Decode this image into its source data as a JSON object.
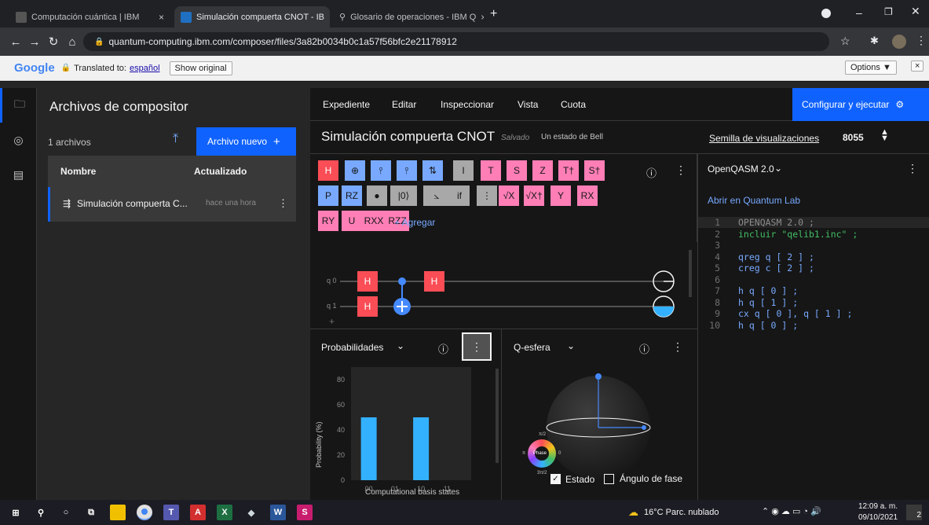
{
  "browser": {
    "tabs": [
      {
        "title": "Computación cuántica | IBM",
        "close": "×"
      },
      {
        "title": "Simulación compuerta CNOT - IB",
        "close": "×"
      },
      {
        "title": "Glosario de operaciones - IBM Q",
        "close": "×"
      }
    ],
    "new_tab": "+",
    "url": "quantum-computing.ibm.com/composer/files/3a82b0034b0c1a57f56bfc2e21178912",
    "translate": {
      "logo": "Google",
      "translated_to": "Translated to:",
      "language": "español",
      "show_original": "Show original",
      "options": "Options ▼",
      "close": "×"
    }
  },
  "files": {
    "title": "Archivos de compositor",
    "count": "1 archivos",
    "new_file": "Archivo nuevo",
    "plus": "+",
    "columns": {
      "name": "Nombre",
      "updated": "Actualizado"
    },
    "rows": [
      {
        "name": "Simulación compuerta C...",
        "updated": "hace una hora"
      }
    ]
  },
  "composer": {
    "menu": [
      "Expediente",
      "Editar",
      "Inspeccionar",
      "Vista",
      "Cuota"
    ],
    "run_label": "Configurar y ejecutar",
    "title": "Simulación compuerta CNOT",
    "saved": "Salvado",
    "tag": "Un estado de Bell",
    "seed_label": "Semilla de visualizaciones",
    "seed_value": "8055",
    "add_gate": "+ Agregar",
    "gates_row1": [
      "H",
      "⊕",
      "⫯",
      "⫯",
      "⇅",
      "I",
      "T",
      "S",
      "Z",
      "T†",
      "S†"
    ],
    "gates_row2": [
      "P",
      "RZ",
      "●",
      "|0⟩",
      "⦣",
      "if",
      "⋮",
      "√X",
      "√X†",
      "Y",
      "RX"
    ],
    "gates_row3": [
      "RY",
      "U",
      "RXX",
      "RZZ"
    ],
    "qubits": [
      "q 0",
      "q 1"
    ],
    "circuit_gates": {
      "h": "H",
      "target": "+"
    }
  },
  "probabilities": {
    "title": "Probabilidades",
    "xlabel": "Computational basis states",
    "ylabel": "Probability (%)"
  },
  "chart_data": {
    "type": "bar",
    "categories": [
      "00",
      "01",
      "10",
      "11"
    ],
    "values": [
      50,
      0,
      50,
      0
    ],
    "xlabel": "Computational basis states",
    "ylabel": "Probability (%)",
    "yticks": [
      0,
      20,
      40,
      60,
      80
    ],
    "ylim": [
      0,
      90
    ],
    "color": "#33b1ff"
  },
  "qsphere": {
    "title": "Q-esfera",
    "state_label": "Estado",
    "phase_label": "Ángulo de fase",
    "phase_wheel": {
      "center": "Phase",
      "top": "π/2",
      "left": "π",
      "right": "0",
      "bottom": "3π/2"
    }
  },
  "qasm": {
    "header": "OpenQASM 2.0",
    "lab_link": "Abrir en Quantum Lab",
    "lines": [
      {
        "n": "1",
        "code": "OPENQASM 2.0 ;"
      },
      {
        "n": "2",
        "code": "incluir \"qelib1.inc\" ;"
      },
      {
        "n": "3",
        "code": ""
      },
      {
        "n": "4",
        "code": "qreg q [ 2 ] ;"
      },
      {
        "n": "5",
        "code": "creg c [ 2 ] ;"
      },
      {
        "n": "6",
        "code": ""
      },
      {
        "n": "7",
        "code": "h q [ 0 ] ;"
      },
      {
        "n": "8",
        "code": "h q [ 1 ] ;"
      },
      {
        "n": "9",
        "code": "cx q [ 0 ], q [ 1 ] ;"
      },
      {
        "n": "10",
        "code": "h q [ 0 ] ;"
      }
    ]
  },
  "taskbar": {
    "weather": "16°C  Parc. nublado",
    "time": "12:09 a. m.",
    "date": "09/10/2021",
    "notif": "2"
  },
  "colors": {
    "accent": "#0f62fe",
    "gate_red": "#fa4d56",
    "gate_blue": "#78a9ff",
    "gate_pink": "#ff7eb6",
    "bar": "#33b1ff"
  }
}
